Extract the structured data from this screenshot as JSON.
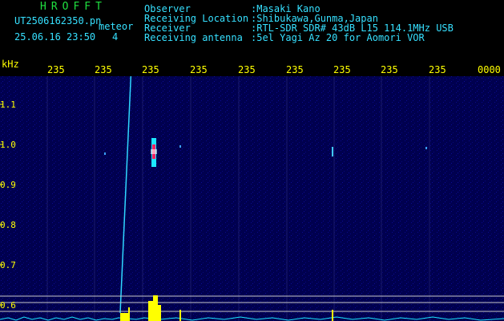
{
  "header": {
    "brand": "HROFFT",
    "file_name": "UT2506162350.pn",
    "object": "meteor",
    "timestamp": "25.06.16 23:50",
    "flag": "4",
    "fields": [
      {
        "label": "Observer",
        "value": ":Masaki Kano"
      },
      {
        "label": "Receiving Location",
        "value": ":Shibukawa,Gunma,Japan"
      },
      {
        "label": "Receiver",
        "value": ":RTL-SDR SDR# 43dB L15 114.1MHz USB"
      },
      {
        "label": "Receiving antenna",
        "value": ":5el Yagi Az 20 for Aomori VOR"
      }
    ]
  },
  "spectrogram": {
    "unit": "kHz",
    "time_labels": [
      "235",
      "235",
      "235",
      "235",
      "235",
      "235",
      "235",
      "235",
      "235",
      "0000"
    ],
    "freq_labels": [
      "1.1",
      "1.0",
      "0.9",
      "0.8",
      "0.7",
      "0.6"
    ],
    "colors": {
      "background": "#00005a",
      "signal": "#1ce8ff",
      "alert": "#ff2060",
      "trace": "#ffff00"
    }
  }
}
